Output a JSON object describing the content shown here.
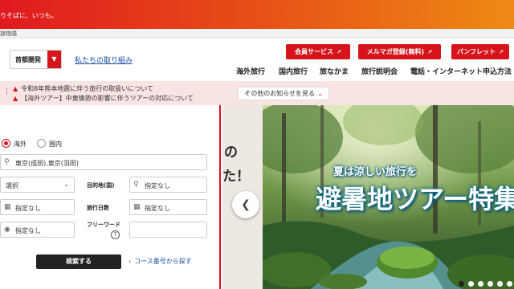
{
  "topbar": {
    "tagline": "りそばに、いつも。"
  },
  "breadcrumb": {
    "text": "旅物語"
  },
  "header": {
    "region_select": "首都圏発",
    "torikumi_link": "私たちの取り組み",
    "buttons": [
      {
        "label": "会員サービス"
      },
      {
        "label": "メルマガ登録(無料)"
      },
      {
        "label": "パンフレット"
      }
    ],
    "nav": [
      "海外旅行",
      "国内旅行",
      "旅なかま",
      "旅行説明会",
      "電話・インターネット申込方法"
    ]
  },
  "notice": {
    "items": [
      "令和8年熊本地震に伴う旅行の取扱いについて",
      "【海外ツアー】中東情勢の影響に伴うツアーの対応について"
    ],
    "more_button": "その他のお知らせを見る"
  },
  "search": {
    "tabs": [
      "海外",
      "国内"
    ],
    "selected_tab": "海外",
    "departure": "東京(成田),東京(羽田)",
    "select_placeholder": "選択",
    "destination_label": "目的地(国)",
    "destination_value": "指定なし",
    "date_value": "指定なし",
    "days_label": "旅行日数",
    "days_value": "指定なし",
    "budget_value": "指定なし",
    "freeword_label": "フリーワード",
    "help_symbol": "?",
    "search_button": "検索する",
    "course_link": "コース番号から探す"
  },
  "carousel": {
    "peek_text_1": "の",
    "peek_text_2": "た！",
    "headline_sub": "夏は涼しい旅行を",
    "headline_main": "避暑地ツアー特集",
    "dots_total": 6,
    "dot_active": 0
  },
  "colors": {
    "brand_red": "#d7141b",
    "link_blue": "#1a4fa0",
    "notice_bg": "#f9e4e4"
  }
}
